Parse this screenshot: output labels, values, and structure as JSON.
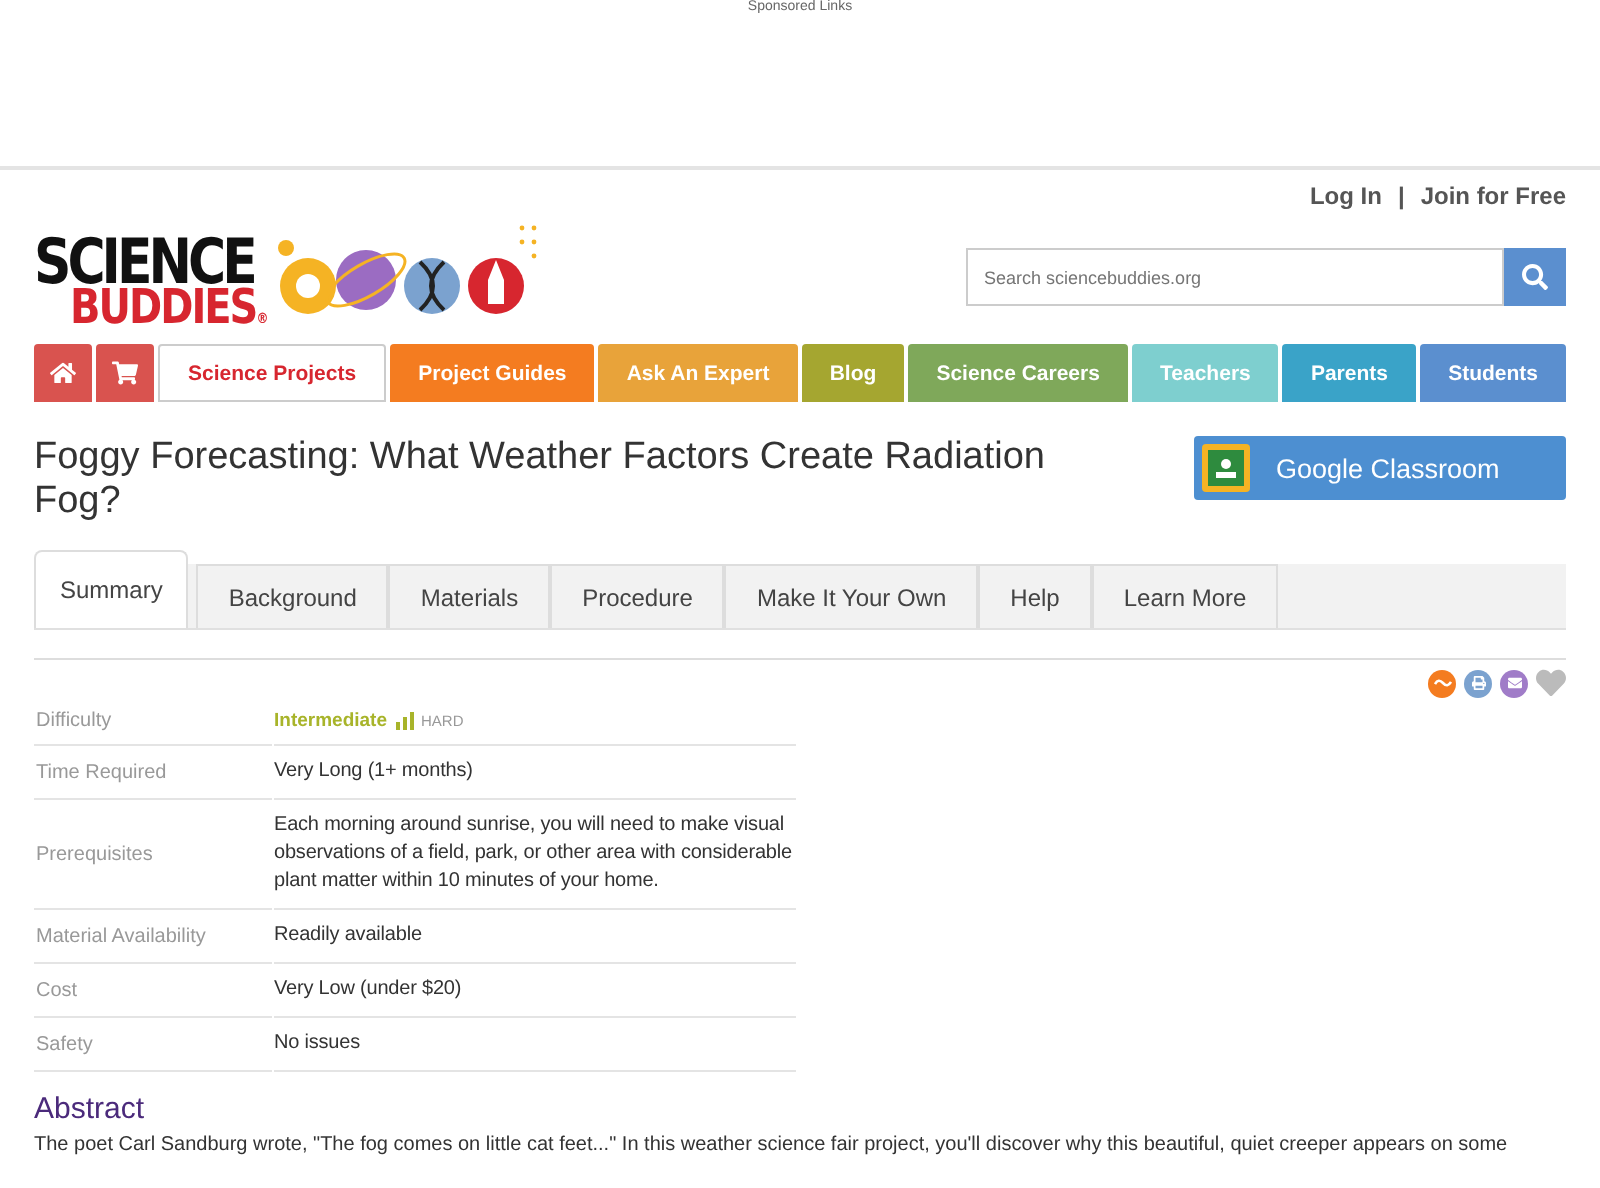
{
  "ad_label": "Sponsored Links",
  "account_links": [
    {
      "label": "Log In"
    },
    {
      "label": "Join for Free"
    }
  ],
  "account_separator": "|",
  "logo": {
    "line_1": "SCIENCE",
    "line_2": "BUDDIES",
    "mark": "®"
  },
  "search": {
    "placeholder": "Search sciencebuddies.org"
  },
  "nav": [
    {
      "kind": "home",
      "color": "#d9534f",
      "selected": false
    },
    {
      "kind": "cart",
      "color": "#d9534f",
      "selected": false
    },
    {
      "kind": "text",
      "label": "Science Projects",
      "color": "#ffffff",
      "selected": true
    },
    {
      "kind": "text",
      "label": "Project Guides",
      "color": "#f47c20",
      "selected": false
    },
    {
      "kind": "text",
      "label": "Ask An Expert",
      "color": "#e8a33a",
      "selected": false
    },
    {
      "kind": "text",
      "label": "Blog",
      "color": "#a5a630",
      "selected": false
    },
    {
      "kind": "text",
      "label": "Science Careers",
      "color": "#7fa85a",
      "selected": false
    },
    {
      "kind": "text",
      "label": "Teachers",
      "color": "#7ecfcf",
      "selected": false
    },
    {
      "kind": "text",
      "label": "Parents",
      "color": "#3aa3c8",
      "selected": false
    },
    {
      "kind": "text",
      "label": "Students",
      "color": "#5b8fcf",
      "selected": false
    }
  ],
  "title": "Foggy Forecasting: What Weather Factors Create Radiation Fog?",
  "classroom_button": "Google Classroom",
  "tabs": [
    {
      "label": "Summary",
      "selected": true
    },
    {
      "label": "Background",
      "selected": false
    },
    {
      "label": "Materials",
      "selected": false
    },
    {
      "label": "Procedure",
      "selected": false
    },
    {
      "label": "Make It Your Own",
      "selected": false
    },
    {
      "label": "Help",
      "selected": false
    },
    {
      "label": "Learn More",
      "selected": false
    }
  ],
  "summary": [
    {
      "kind": "difficulty",
      "label": "Difficulty",
      "value": "Intermediate",
      "note": "HARD"
    },
    {
      "kind": "text",
      "label": "Time Required",
      "value": "Very Long (1+ months)"
    },
    {
      "kind": "text",
      "label": "Prerequisites",
      "value": "Each morning around sunrise, you will need to make visual observations of a field, park, or other area with considerable plant matter within 10 minutes of your home."
    },
    {
      "kind": "text",
      "label": "Material Availability",
      "value": "Readily available"
    },
    {
      "kind": "text",
      "label": "Cost",
      "value": "Very Low (under $20)"
    },
    {
      "kind": "text",
      "label": "Safety",
      "value": "No issues"
    }
  ],
  "abstract": {
    "heading": "Abstract",
    "text": "The poet Carl Sandburg wrote, \"The fog comes on little cat feet...\" In this weather science fair project, you'll discover why this beautiful, quiet creeper appears on some"
  }
}
